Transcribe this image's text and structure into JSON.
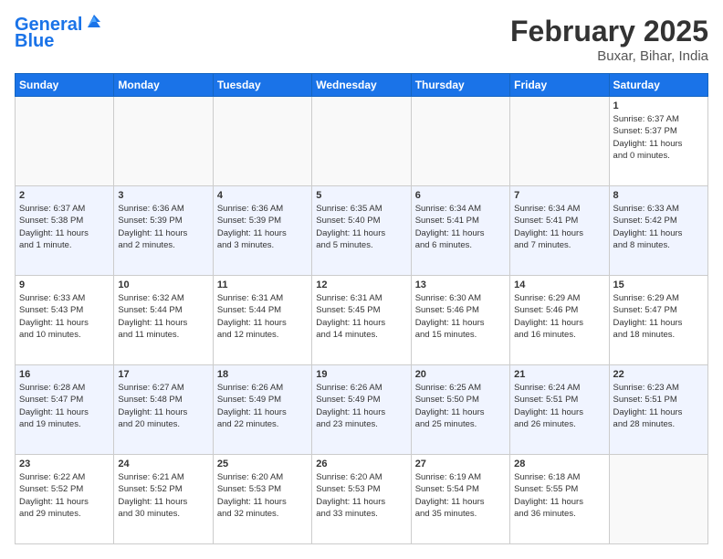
{
  "header": {
    "logo_line1": "General",
    "logo_line2": "Blue",
    "month": "February 2025",
    "location": "Buxar, Bihar, India"
  },
  "days_of_week": [
    "Sunday",
    "Monday",
    "Tuesday",
    "Wednesday",
    "Thursday",
    "Friday",
    "Saturday"
  ],
  "weeks": [
    [
      {
        "day": "",
        "info": ""
      },
      {
        "day": "",
        "info": ""
      },
      {
        "day": "",
        "info": ""
      },
      {
        "day": "",
        "info": ""
      },
      {
        "day": "",
        "info": ""
      },
      {
        "day": "",
        "info": ""
      },
      {
        "day": "1",
        "info": "Sunrise: 6:37 AM\nSunset: 5:37 PM\nDaylight: 11 hours\nand 0 minutes."
      }
    ],
    [
      {
        "day": "2",
        "info": "Sunrise: 6:37 AM\nSunset: 5:38 PM\nDaylight: 11 hours\nand 1 minute."
      },
      {
        "day": "3",
        "info": "Sunrise: 6:36 AM\nSunset: 5:39 PM\nDaylight: 11 hours\nand 2 minutes."
      },
      {
        "day": "4",
        "info": "Sunrise: 6:36 AM\nSunset: 5:39 PM\nDaylight: 11 hours\nand 3 minutes."
      },
      {
        "day": "5",
        "info": "Sunrise: 6:35 AM\nSunset: 5:40 PM\nDaylight: 11 hours\nand 5 minutes."
      },
      {
        "day": "6",
        "info": "Sunrise: 6:34 AM\nSunset: 5:41 PM\nDaylight: 11 hours\nand 6 minutes."
      },
      {
        "day": "7",
        "info": "Sunrise: 6:34 AM\nSunset: 5:41 PM\nDaylight: 11 hours\nand 7 minutes."
      },
      {
        "day": "8",
        "info": "Sunrise: 6:33 AM\nSunset: 5:42 PM\nDaylight: 11 hours\nand 8 minutes."
      }
    ],
    [
      {
        "day": "9",
        "info": "Sunrise: 6:33 AM\nSunset: 5:43 PM\nDaylight: 11 hours\nand 10 minutes."
      },
      {
        "day": "10",
        "info": "Sunrise: 6:32 AM\nSunset: 5:44 PM\nDaylight: 11 hours\nand 11 minutes."
      },
      {
        "day": "11",
        "info": "Sunrise: 6:31 AM\nSunset: 5:44 PM\nDaylight: 11 hours\nand 12 minutes."
      },
      {
        "day": "12",
        "info": "Sunrise: 6:31 AM\nSunset: 5:45 PM\nDaylight: 11 hours\nand 14 minutes."
      },
      {
        "day": "13",
        "info": "Sunrise: 6:30 AM\nSunset: 5:46 PM\nDaylight: 11 hours\nand 15 minutes."
      },
      {
        "day": "14",
        "info": "Sunrise: 6:29 AM\nSunset: 5:46 PM\nDaylight: 11 hours\nand 16 minutes."
      },
      {
        "day": "15",
        "info": "Sunrise: 6:29 AM\nSunset: 5:47 PM\nDaylight: 11 hours\nand 18 minutes."
      }
    ],
    [
      {
        "day": "16",
        "info": "Sunrise: 6:28 AM\nSunset: 5:47 PM\nDaylight: 11 hours\nand 19 minutes."
      },
      {
        "day": "17",
        "info": "Sunrise: 6:27 AM\nSunset: 5:48 PM\nDaylight: 11 hours\nand 20 minutes."
      },
      {
        "day": "18",
        "info": "Sunrise: 6:26 AM\nSunset: 5:49 PM\nDaylight: 11 hours\nand 22 minutes."
      },
      {
        "day": "19",
        "info": "Sunrise: 6:26 AM\nSunset: 5:49 PM\nDaylight: 11 hours\nand 23 minutes."
      },
      {
        "day": "20",
        "info": "Sunrise: 6:25 AM\nSunset: 5:50 PM\nDaylight: 11 hours\nand 25 minutes."
      },
      {
        "day": "21",
        "info": "Sunrise: 6:24 AM\nSunset: 5:51 PM\nDaylight: 11 hours\nand 26 minutes."
      },
      {
        "day": "22",
        "info": "Sunrise: 6:23 AM\nSunset: 5:51 PM\nDaylight: 11 hours\nand 28 minutes."
      }
    ],
    [
      {
        "day": "23",
        "info": "Sunrise: 6:22 AM\nSunset: 5:52 PM\nDaylight: 11 hours\nand 29 minutes."
      },
      {
        "day": "24",
        "info": "Sunrise: 6:21 AM\nSunset: 5:52 PM\nDaylight: 11 hours\nand 30 minutes."
      },
      {
        "day": "25",
        "info": "Sunrise: 6:20 AM\nSunset: 5:53 PM\nDaylight: 11 hours\nand 32 minutes."
      },
      {
        "day": "26",
        "info": "Sunrise: 6:20 AM\nSunset: 5:53 PM\nDaylight: 11 hours\nand 33 minutes."
      },
      {
        "day": "27",
        "info": "Sunrise: 6:19 AM\nSunset: 5:54 PM\nDaylight: 11 hours\nand 35 minutes."
      },
      {
        "day": "28",
        "info": "Sunrise: 6:18 AM\nSunset: 5:55 PM\nDaylight: 11 hours\nand 36 minutes."
      },
      {
        "day": "",
        "info": ""
      }
    ]
  ]
}
